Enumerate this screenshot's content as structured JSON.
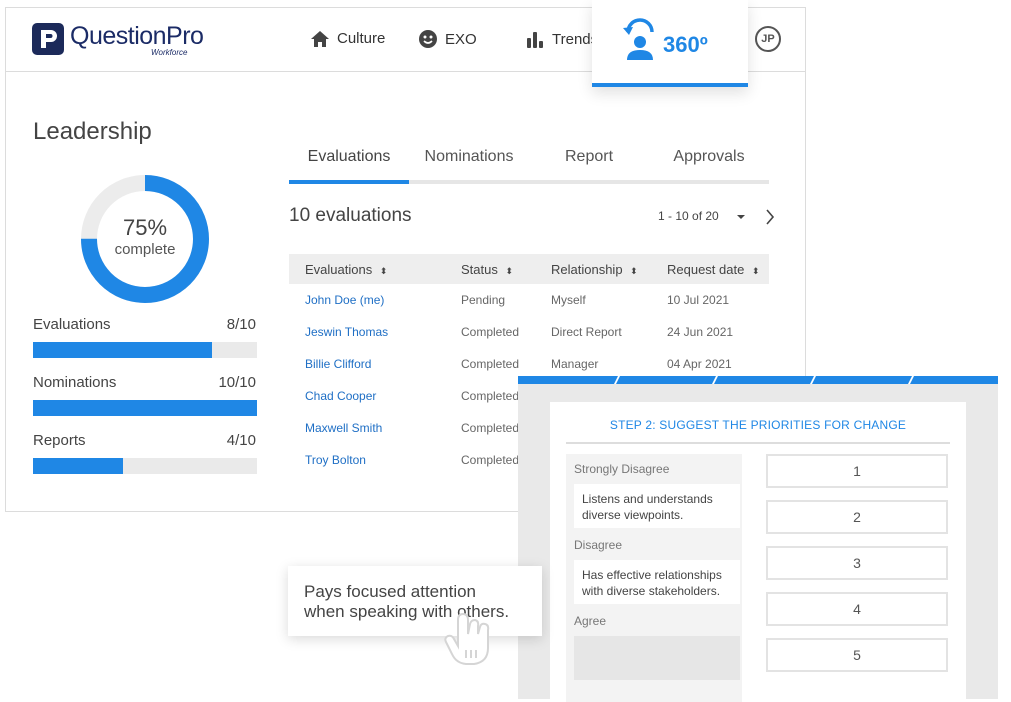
{
  "brand": {
    "name": "QuestionPro",
    "sub": "Workforce",
    "color": "#1b2b66"
  },
  "nav": {
    "items": [
      {
        "label": "Culture",
        "icon": "home-icon"
      },
      {
        "label": "EXO",
        "icon": "smiley-icon"
      },
      {
        "label": "Trends",
        "icon": "bar-chart-icon"
      }
    ],
    "active": {
      "label": "360º",
      "icon": "user-rotate-icon"
    },
    "avatar": "JP"
  },
  "leadership": {
    "title": "Leadership",
    "progress": {
      "percent": 75,
      "pct_label": "75%",
      "sub_label": "complete"
    },
    "metrics": [
      {
        "label": "Evaluations",
        "value": "8/10",
        "fraction": 0.8
      },
      {
        "label": "Nominations",
        "value": "10/10",
        "fraction": 1.0
      },
      {
        "label": "Reports",
        "value": "4/10",
        "fraction": 0.4
      }
    ]
  },
  "tabs": [
    "Evaluations",
    "Nominations",
    "Report",
    "Approvals"
  ],
  "active_tab": "Evaluations",
  "evaluations": {
    "count_label": "10 evaluations",
    "pager": "1 - 10 of 20",
    "columns": [
      "Evaluations",
      "Status",
      "Relationship",
      "Request date"
    ],
    "rows": [
      {
        "name": "John Doe (me)",
        "status": "Pending",
        "relationship": "Myself",
        "date": "10 Jul 2021"
      },
      {
        "name": "Jeswin Thomas",
        "status": "Completed",
        "relationship": "Direct Report",
        "date": "24 Jun 2021"
      },
      {
        "name": "Billie Clifford",
        "status": "Completed",
        "relationship": "Manager",
        "date": "04 Apr 2021"
      },
      {
        "name": "Chad Cooper",
        "status": "Completed",
        "relationship": "",
        "date": ""
      },
      {
        "name": "Maxwell Smith",
        "status": "Completed",
        "relationship": "",
        "date": ""
      },
      {
        "name": "Troy Bolton",
        "status": "Completed",
        "relationship": "",
        "date": ""
      }
    ]
  },
  "survey": {
    "step_title": "STEP 2: SUGGEST THE PRIORITIES FOR CHANGE",
    "groups": [
      {
        "label": "Strongly Disagree",
        "statement": "Listens and understands diverse viewpoints."
      },
      {
        "label": "Disagree",
        "statement": "Has effective relationships with diverse stakeholders."
      },
      {
        "label": "Agree",
        "statement": ""
      }
    ],
    "ranks": [
      "1",
      "2",
      "3",
      "4",
      "5"
    ]
  },
  "drag_card": {
    "line1": "Pays focused attention",
    "line2": "when speaking with others."
  },
  "colors": {
    "accent": "#1f87e5",
    "link": "#1f6fc5"
  }
}
